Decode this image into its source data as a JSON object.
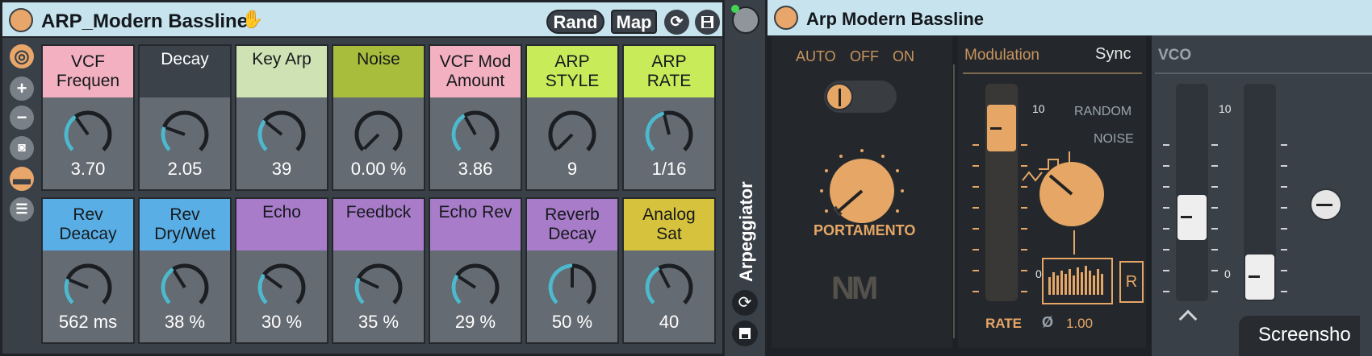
{
  "rack": {
    "title": "ARP_Modern Bassline",
    "rand_label": "Rand",
    "map_label": "Map",
    "macros": [
      {
        "label": "VCF\nFrequen",
        "value": "3.70",
        "color": "#f2b0c0",
        "level": 0.37
      },
      {
        "label": "Decay",
        "value": "2.05",
        "color": "#3b4249",
        "level": 0.24
      },
      {
        "label": "Key Arp",
        "value": "39",
        "color": "#cfe2b3",
        "level": 0.31
      },
      {
        "label": "Noise",
        "value": "0.00 %",
        "color": "#a9bd3c",
        "level": 0.0
      },
      {
        "label": "VCF Mod\nAmount",
        "value": "3.86",
        "color": "#f2b0c0",
        "level": 0.39
      },
      {
        "label": "ARP\nSTYLE",
        "value": "9",
        "color": "#c8eb5a",
        "level": 0.0
      },
      {
        "label": "ARP\nRATE",
        "value": "1/16",
        "color": "#c8eb5a",
        "level": 0.45
      },
      {
        "label": "Rev\nDeacay",
        "value": "562 ms",
        "color": "#5aaee6",
        "level": 0.25
      },
      {
        "label": "Rev\nDry/Wet",
        "value": "38 %",
        "color": "#5aaee6",
        "level": 0.38
      },
      {
        "label": "Echo",
        "value": "30 %",
        "color": "#a87cc8",
        "level": 0.3
      },
      {
        "label": "Feedbck",
        "value": "35 %",
        "color": "#a87cc8",
        "level": 0.26
      },
      {
        "label": "Echo Rev",
        "value": "29 %",
        "color": "#a87cc8",
        "level": 0.29
      },
      {
        "label": "Reverb\nDecay",
        "value": "50 %",
        "color": "#a87cc8",
        "level": 0.5
      },
      {
        "label": "Analog\nSat",
        "value": "40",
        "color": "#d6c23c",
        "level": 0.4
      }
    ],
    "strip_label": "Arpeggiator"
  },
  "device": {
    "title": "Arp Modern Bassline",
    "mode_labels": [
      "AUTO",
      "OFF",
      "ON"
    ],
    "portamento_label": "PORTAMENTO",
    "logo_text": "NM",
    "modulation_label": "Modulation",
    "sync_label": "Sync",
    "rate_label": "RATE",
    "scale_top": "10",
    "scale_bottom": "0",
    "wave_labels": [
      "RANDOM",
      "NOISE"
    ],
    "r_button": "R",
    "phase_symbol": "Ø",
    "phase_value": "1.00",
    "vco_label": "VCO",
    "vco_scale_top": "10",
    "vco_scale_bottom": "0"
  },
  "tooltip": {
    "text": "Screensho"
  },
  "colors": {
    "accent": "#e5a666",
    "teal": "#4fb8cc"
  }
}
